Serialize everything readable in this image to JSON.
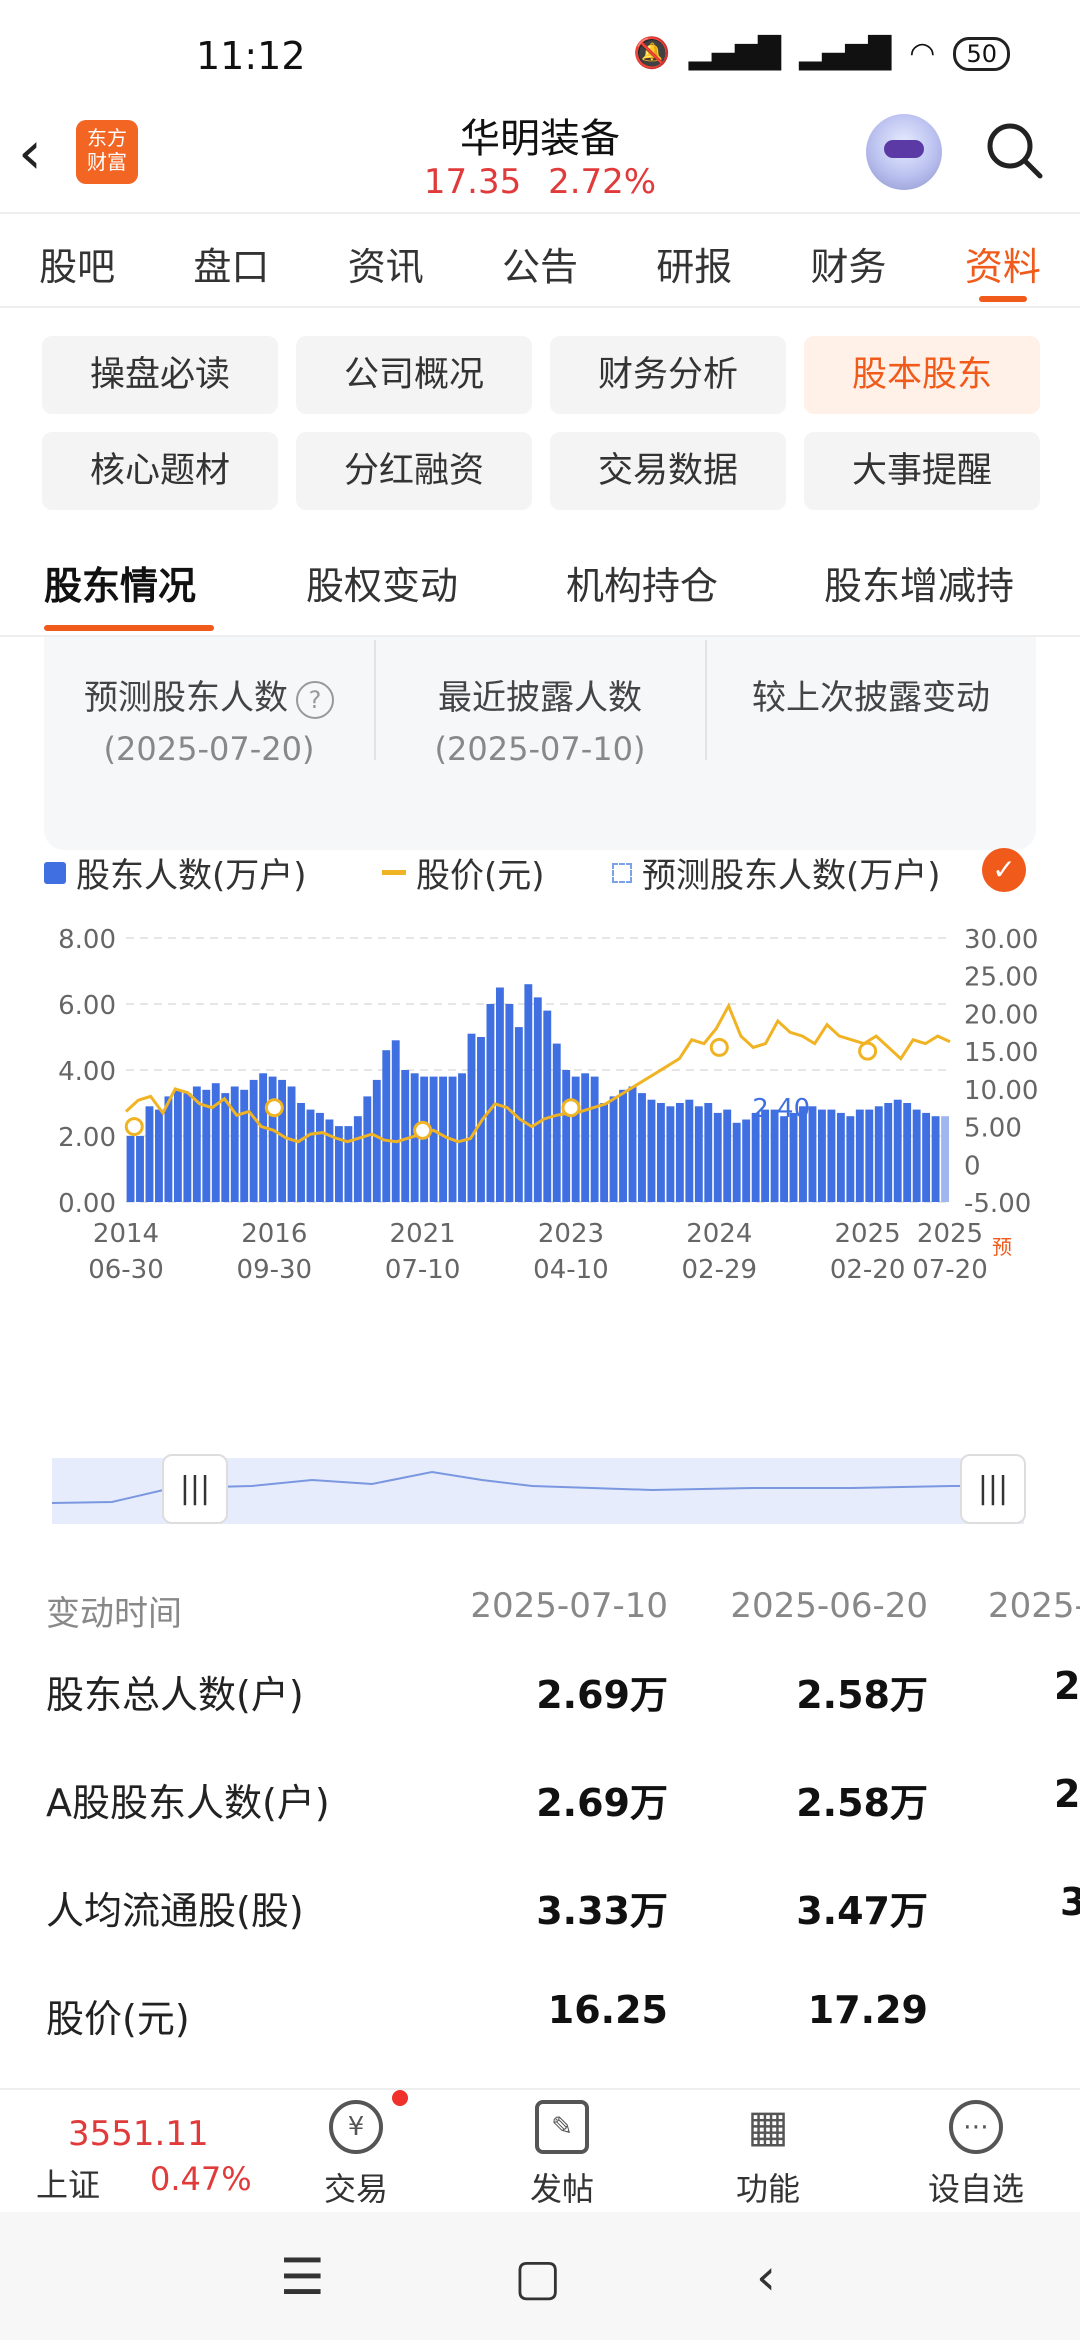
{
  "status": {
    "time": "11:12",
    "battery": "50"
  },
  "header": {
    "logo_line1": "东方",
    "logo_line2": "财富",
    "title": "华明装备",
    "price": "17.35",
    "change_pct": "2.72%"
  },
  "main_tabs": [
    "股吧",
    "盘口",
    "资讯",
    "公告",
    "研报",
    "财务",
    "资料"
  ],
  "chips": [
    "操盘必读",
    "公司概况",
    "财务分析",
    "股本股东",
    "核心题材",
    "分红融资",
    "交易数据",
    "大事提醒"
  ],
  "section_tabs": [
    "股东情况",
    "股权变动",
    "机构持仓",
    "股东增减持"
  ],
  "summary": [
    {
      "label": "预测股东人数",
      "date": "(2025-07-20)"
    },
    {
      "label": "最近披露人数",
      "date": "(2025-07-10)"
    },
    {
      "label": "较上次披露变动",
      "date": ""
    }
  ],
  "legend": {
    "holders": "股东人数(万户)",
    "price": "股价(元)",
    "forecast": "预测股东人数(万户)"
  },
  "chart_data": {
    "type": "bar",
    "left_axis_ticks": [
      "8.00",
      "6.00",
      "4.00",
      "2.00",
      "0.00"
    ],
    "right_axis_ticks": [
      "30.00",
      "25.00",
      "20.00",
      "15.00",
      "10.00",
      "5.00",
      "0",
      "-5.00"
    ],
    "ylim_left": [
      0,
      8
    ],
    "ylim_right": [
      -5,
      30
    ],
    "x_ticks": [
      {
        "year": "2014",
        "date": "06-30"
      },
      {
        "year": "2016",
        "date": "09-30"
      },
      {
        "year": "2021",
        "date": "07-10"
      },
      {
        "year": "2023",
        "date": "04-10"
      },
      {
        "year": "2024",
        "date": "02-29"
      },
      {
        "year": "2025",
        "date": "02-20"
      },
      {
        "year": "2025",
        "date": "07-20"
      }
    ],
    "forecast_marker": "预",
    "annotation": "2.40",
    "holders_series": [
      2.0,
      2.0,
      2.9,
      2.8,
      3.2,
      3.4,
      3.3,
      3.5,
      3.4,
      3.6,
      3.3,
      3.5,
      3.4,
      3.7,
      3.9,
      3.8,
      3.7,
      3.5,
      3.0,
      2.8,
      2.7,
      2.5,
      2.3,
      2.3,
      2.6,
      3.2,
      3.7,
      4.6,
      4.9,
      4.0,
      3.9,
      3.8,
      3.8,
      3.8,
      3.8,
      3.9,
      5.1,
      5.0,
      6.0,
      6.5,
      6.0,
      5.3,
      6.6,
      6.2,
      5.8,
      4.8,
      4.0,
      3.8,
      3.9,
      3.8,
      3.0,
      3.2,
      3.4,
      3.5,
      3.3,
      3.1,
      3.0,
      2.9,
      3.0,
      3.1,
      2.9,
      3.0,
      2.7,
      2.8,
      2.4,
      2.5,
      2.7,
      2.8,
      2.8,
      2.6,
      2.7,
      2.9,
      2.9,
      2.8,
      2.8,
      2.7,
      2.6,
      2.8,
      2.8,
      2.9,
      3.0,
      3.1,
      3.0,
      2.8,
      2.7,
      2.6,
      2.6
    ],
    "price_series": [
      7.0,
      8.5,
      9.0,
      6.8,
      10.0,
      9.5,
      8.0,
      7.5,
      8.7,
      6.5,
      7.0,
      5.0,
      4.5,
      3.5,
      3.0,
      4.0,
      4.2,
      3.5,
      3.0,
      3.5,
      4.0,
      3.2,
      3.0,
      3.5,
      4.0,
      4.5,
      3.6,
      3.0,
      3.4,
      6.0,
      8.0,
      7.5,
      6.0,
      5.0,
      6.0,
      6.5,
      6.8,
      7.0,
      7.5,
      8.0,
      9.0,
      10.0,
      11.0,
      12.0,
      13.0,
      14.0,
      16.5,
      16.0,
      18.0,
      21.0,
      17.0,
      15.5,
      16.0,
      19.0,
      17.5,
      17.0,
      16.0,
      18.5,
      17.0,
      16.5,
      16.0,
      17.0,
      15.5,
      14.0,
      16.5,
      16.0,
      17.0,
      16.25
    ],
    "price_markers": [
      [
        0.01,
        5.0
      ],
      [
        0.18,
        7.5
      ],
      [
        0.36,
        4.5
      ],
      [
        0.54,
        7.5
      ],
      [
        0.72,
        15.5
      ],
      [
        0.9,
        15.0
      ]
    ]
  },
  "table": {
    "header": {
      "label": "变动时间",
      "cols": [
        "2025-07-10",
        "2025-06-20",
        "2025-"
      ]
    },
    "rows": [
      {
        "label": "股东总人数(户)",
        "cols": [
          "2.69万",
          "2.58万",
          "2"
        ]
      },
      {
        "label": "A股股东人数(户)",
        "cols": [
          "2.69万",
          "2.58万",
          "2"
        ]
      },
      {
        "label": "人均流通股(股)",
        "cols": [
          "3.33万",
          "3.47万",
          "3"
        ]
      },
      {
        "label": "股价(元)",
        "cols": [
          "16.25",
          "17.29",
          ""
        ]
      }
    ]
  },
  "bottom_nav": {
    "index_value": "3551.11",
    "index_name": "上证",
    "index_pct": "0.47%",
    "items": [
      "交易",
      "发帖",
      "功能",
      "设自选"
    ],
    "icons": [
      "¥",
      "✎",
      "▦",
      "⋯"
    ]
  }
}
